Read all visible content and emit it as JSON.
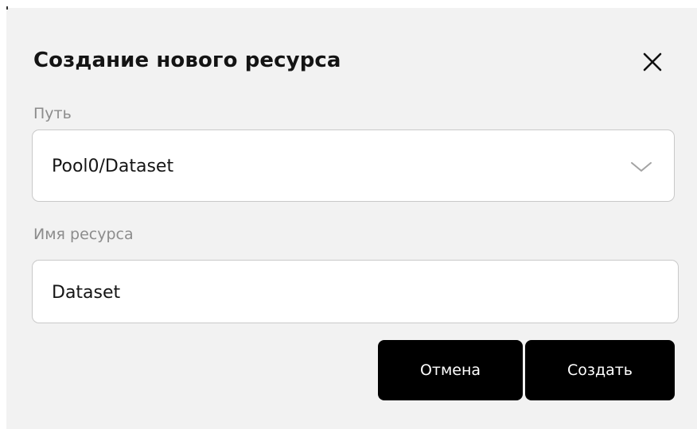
{
  "dialog": {
    "title": "Создание нового ресурса",
    "close_icon": "close-icon"
  },
  "path_field": {
    "label": "Путь",
    "value": "Pool0/Dataset",
    "dropdown_icon": "chevron-down-icon"
  },
  "name_field": {
    "label": "Имя ресурса",
    "value": "Dataset"
  },
  "actions": {
    "cancel_label": "Отмена",
    "create_label": "Создать"
  },
  "colors": {
    "dialog_background": "#f2f2f2",
    "button_background": "#000000",
    "button_text": "#ffffff",
    "label_text": "#8c8c8c"
  }
}
